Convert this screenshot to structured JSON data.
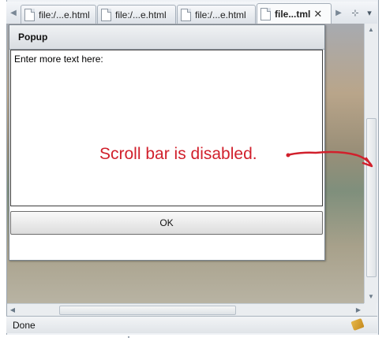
{
  "tabs": [
    {
      "label": "file:/...e.html",
      "active": false
    },
    {
      "label": "file:/...e.html",
      "active": false
    },
    {
      "label": "file:/...e.html",
      "active": false
    },
    {
      "label": "file...tml",
      "active": true
    }
  ],
  "tab_close_glyph": "✕",
  "tab_scroll_left_glyph": "◀",
  "tab_scroll_right_glyph": "▶",
  "tab_tools": {
    "pin_glyph": "⊹",
    "menu_glyph": "▾"
  },
  "popup": {
    "title": "Popup",
    "textarea_value": "Enter more text here:",
    "ok_label": "OK"
  },
  "annotation": {
    "text": "Scroll bar is disabled.",
    "color": "#d1202c"
  },
  "statusbar": {
    "text": "Done"
  },
  "icons": [
    "page-icon",
    "close-icon",
    "chevron-left-icon",
    "chevron-right-icon",
    "pin-icon",
    "dropdown-icon",
    "status-icon"
  ]
}
